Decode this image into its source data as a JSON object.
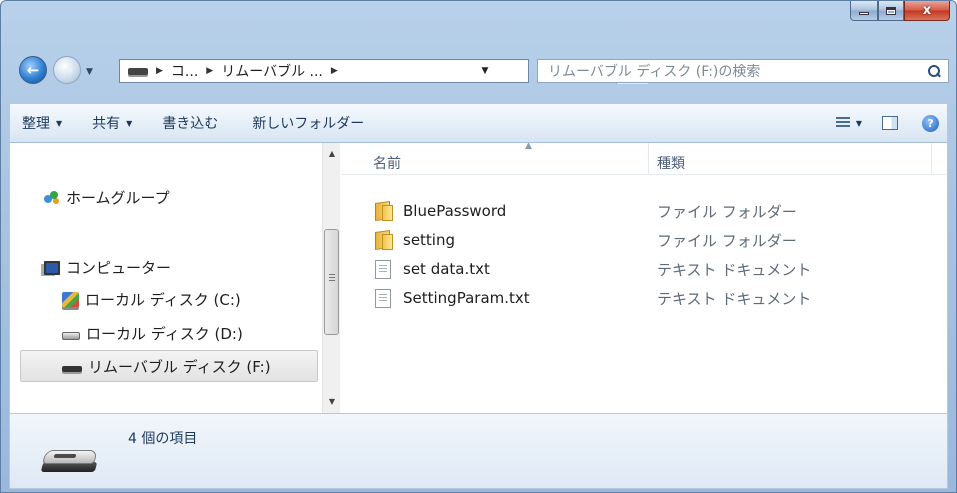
{
  "window": {
    "caption_buttons": {
      "minimize": "_",
      "maximize": "□",
      "close": "x"
    }
  },
  "navigation": {
    "back_icon": "back-arrow-icon",
    "forward_icon": "forward-arrow-icon",
    "breadcrumbs": [
      "コ...",
      "リムーバブル ..."
    ],
    "search_placeholder": "リムーバブル ディスク (F:)の検索"
  },
  "toolbar": {
    "organize": "整理",
    "share": "共有",
    "burn": "書き込む",
    "new_folder": "新しいフォルダー"
  },
  "sidebar": {
    "items": [
      {
        "label": "ホームグループ",
        "icon": "homegroup-icon"
      },
      {
        "label": "コンピューター",
        "icon": "computer-icon"
      },
      {
        "label": "ローカル ディスク (C:)",
        "icon": "local-disk-c-icon"
      },
      {
        "label": "ローカル ディスク (D:)",
        "icon": "local-disk-d-icon"
      },
      {
        "label": "リムーバブル ディスク (F:)",
        "icon": "removable-disk-icon",
        "selected": true
      }
    ]
  },
  "file_list": {
    "columns": {
      "name": "名前",
      "type": "種類"
    },
    "rows": [
      {
        "name": "BluePassword",
        "type": "ファイル フォルダー",
        "icon": "folder-icon"
      },
      {
        "name": "setting",
        "type": "ファイル フォルダー",
        "icon": "folder-icon"
      },
      {
        "name": "set data.txt",
        "type": "テキスト ドキュメント",
        "icon": "text-file-icon"
      },
      {
        "name": "SettingParam.txt",
        "type": "テキスト ドキュメント",
        "icon": "text-file-icon"
      }
    ]
  },
  "details": {
    "item_count": "4 個の項目"
  },
  "colors": {
    "frame": "#a9c4e2",
    "toolbar": "#e6eff8",
    "close_button": "#c3371f",
    "selection": "#e2e2e2"
  }
}
